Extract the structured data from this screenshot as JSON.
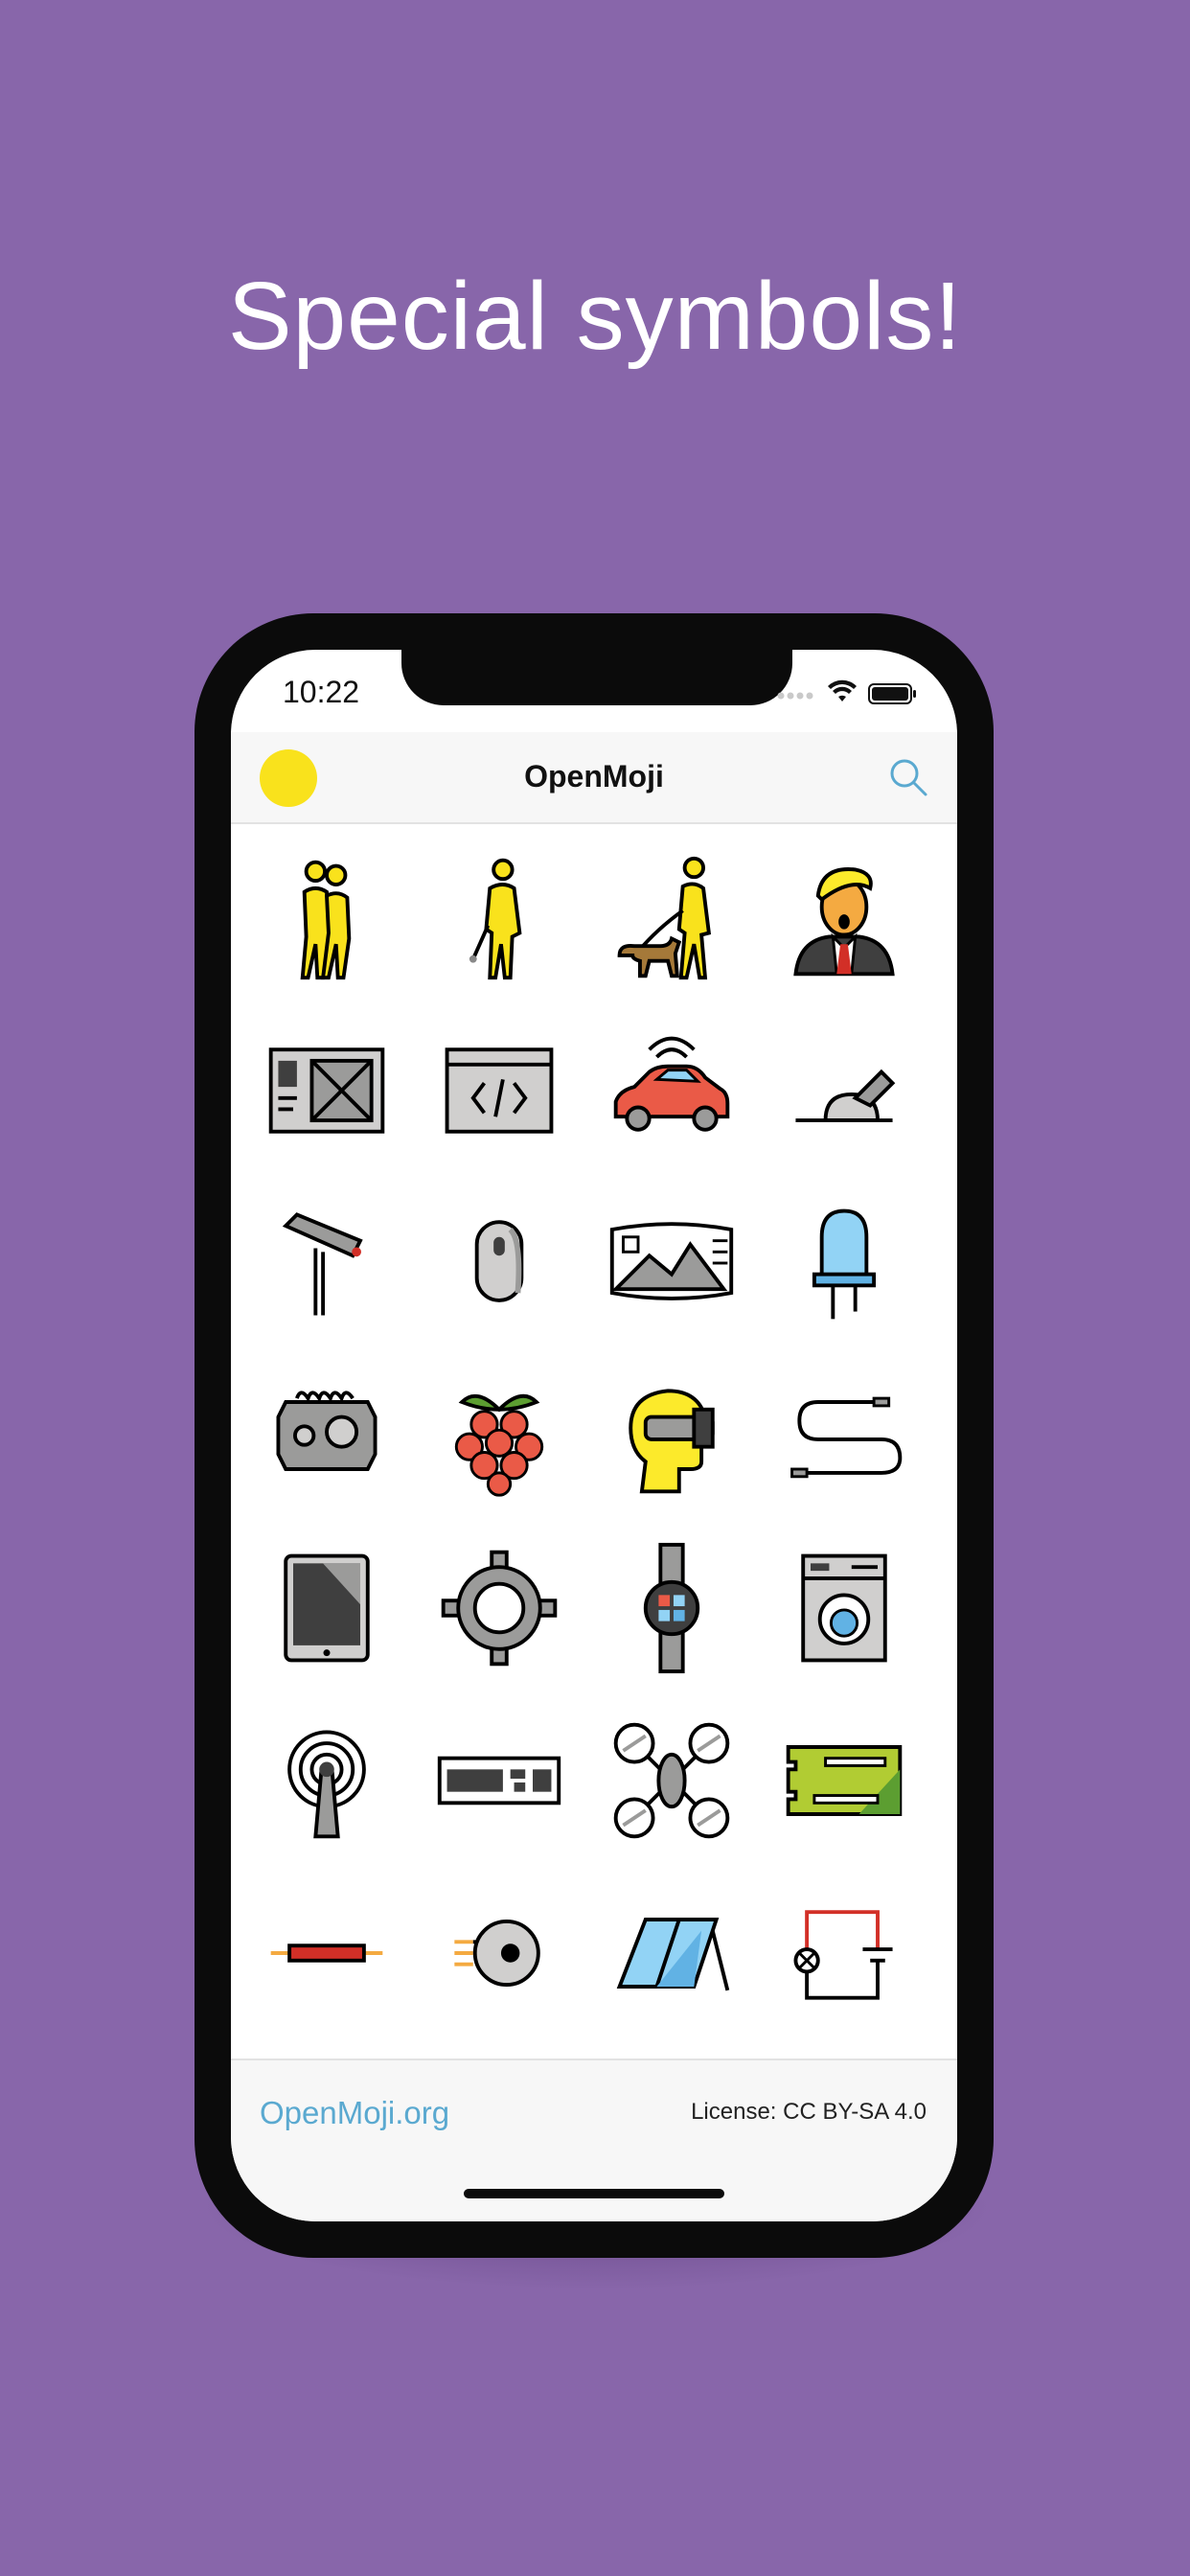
{
  "headline": "Special symbols!",
  "status": {
    "time": "10:22"
  },
  "navbar": {
    "title": "OpenMoji",
    "dot_color": "#f9e21c",
    "search_icon": "search-icon"
  },
  "footer": {
    "link": "OpenMoji.org",
    "license": "License: CC BY-SA 4.0"
  },
  "colors": {
    "background": "#8866aa",
    "accent": "#5aa9d0",
    "emoji_yellow": "#f9e21c"
  },
  "emoji_grid": [
    "people-hugging-icon",
    "person-with-white-cane-icon",
    "person-walking-guide-dog-icon",
    "man-in-suit-orange-face-icon",
    "wireframe-layout-icon",
    "code-window-icon",
    "connected-car-icon",
    "joystick-lever-icon",
    "security-camera-icon",
    "computer-mouse-icon",
    "panorama-photo-icon",
    "led-diode-icon",
    "microchip-icon",
    "raspberry-icon",
    "vr-headset-person-icon",
    "cable-connector-icon",
    "tablet-icon",
    "crosshair-ring-icon",
    "smartwatch-icon",
    "washing-machine-icon",
    "broadcast-antenna-icon",
    "keyboard-icon",
    "quadcopter-drone-icon",
    "circuit-board-icon",
    "resistor-icon",
    "rotary-encoder-icon",
    "solar-panel-icon",
    "electric-circuit-icon"
  ]
}
